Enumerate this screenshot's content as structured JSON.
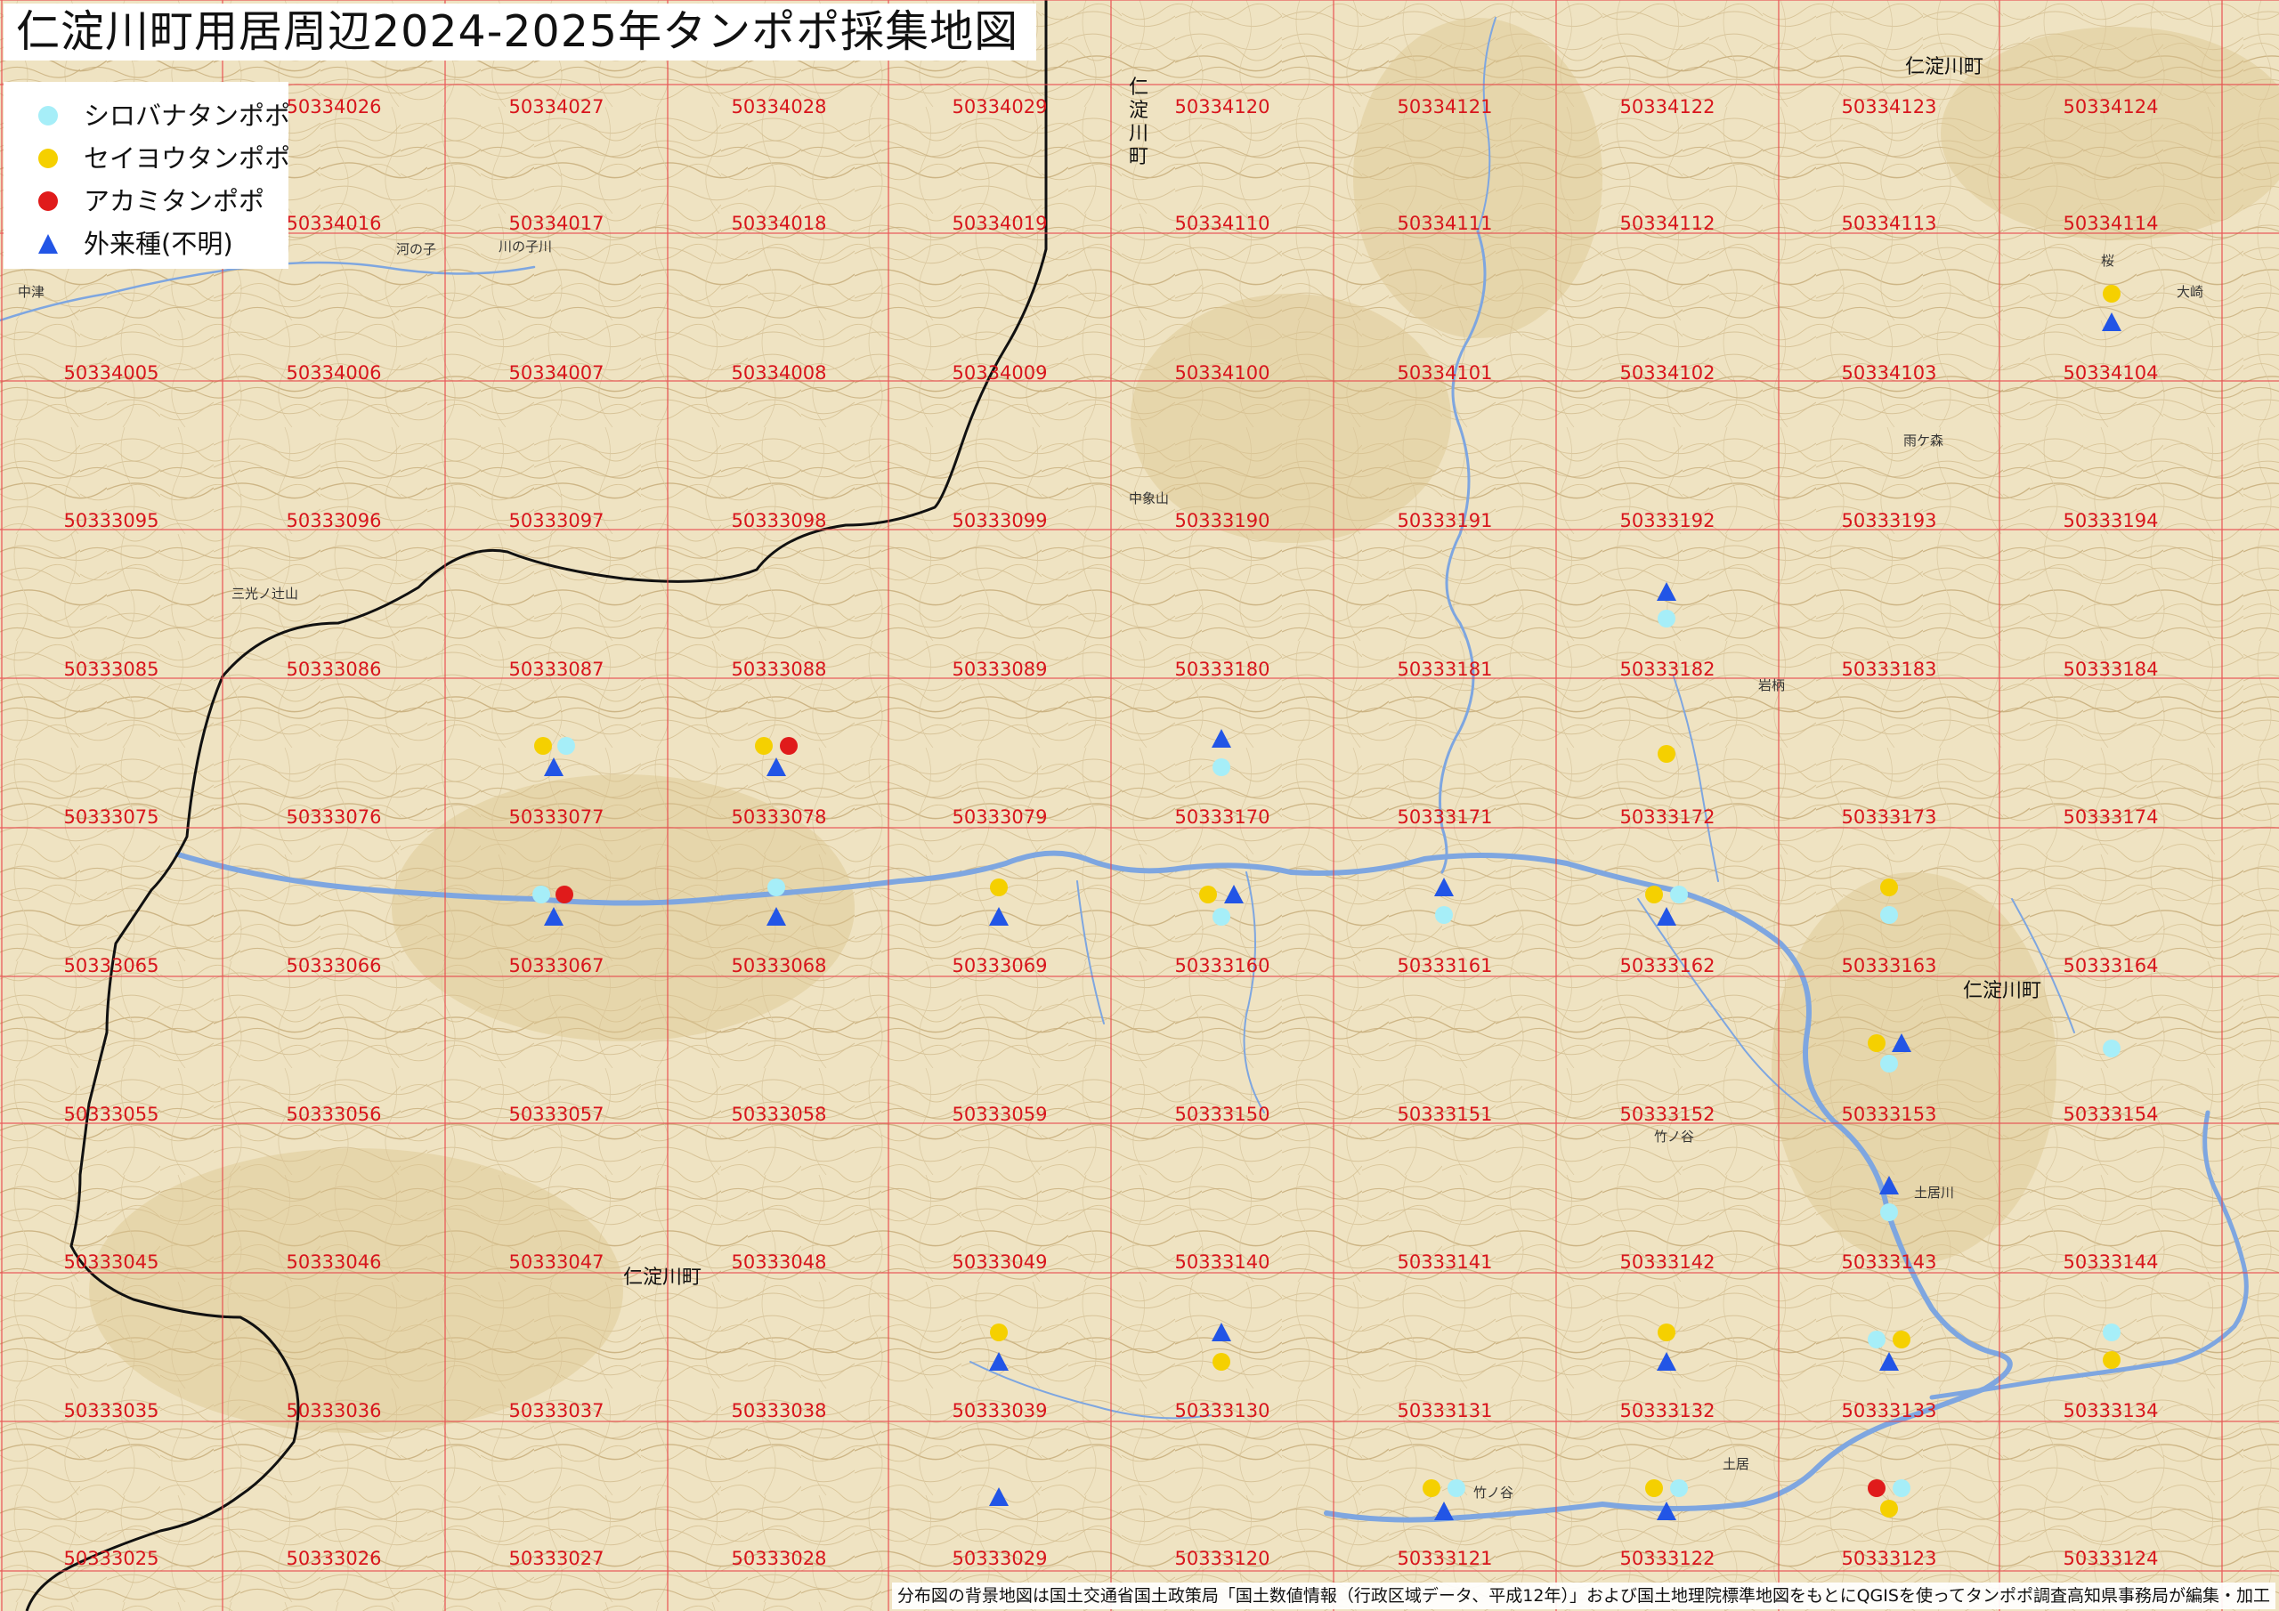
{
  "title": "仁淀川町用居周辺2024-2025年タンポポ採集地図",
  "legend": [
    {
      "key": "shirobana",
      "label": "シロバナタンポポ",
      "color": "#a6eef8",
      "shape": "circle"
    },
    {
      "key": "seiyou",
      "label": "セイヨウタンポポ",
      "color": "#f5d000",
      "shape": "circle"
    },
    {
      "key": "akami",
      "label": "アカミタンポポ",
      "color": "#e01b1b",
      "shape": "circle"
    },
    {
      "key": "gairai",
      "label": "外来種(不明)",
      "color": "#2255e6",
      "shape": "triangle"
    }
  ],
  "grid_rows": [
    [
      "50334026",
      "50334027",
      "50334028",
      "50334029",
      "50334120",
      "50334121",
      "50334122",
      "50334123",
      "50334124"
    ],
    [
      "50334016",
      "50334017",
      "50334018",
      "50334019",
      "50334110",
      "50334111",
      "50334112",
      "50334113",
      "50334114"
    ],
    [
      "50334005",
      "50334006",
      "50334007",
      "50334008",
      "50334009",
      "50334100",
      "50334101",
      "50334102",
      "50334103",
      "50334104"
    ],
    [
      "50333095",
      "50333096",
      "50333097",
      "50333098",
      "50333099",
      "50333190",
      "50333191",
      "50333192",
      "50333193",
      "50333194"
    ],
    [
      "50333085",
      "50333086",
      "50333087",
      "50333088",
      "50333089",
      "50333180",
      "50333181",
      "50333182",
      "50333183",
      "50333184"
    ],
    [
      "50333075",
      "50333076",
      "50333077",
      "50333078",
      "50333079",
      "50333170",
      "50333171",
      "50333172",
      "50333173",
      "50333174"
    ],
    [
      "50333065",
      "50333066",
      "50333067",
      "50333068",
      "50333069",
      "50333160",
      "50333161",
      "50333162",
      "50333163",
      "50333164"
    ],
    [
      "50333055",
      "50333056",
      "50333057",
      "50333058",
      "50333059",
      "50333150",
      "50333151",
      "50333152",
      "50333153",
      "50333154"
    ],
    [
      "50333045",
      "50333046",
      "50333047",
      "50333048",
      "50333049",
      "50333140",
      "50333141",
      "50333142",
      "50333143",
      "50333144"
    ],
    [
      "50333035",
      "50333036",
      "50333037",
      "50333038",
      "50333039",
      "50333130",
      "50333131",
      "50333132",
      "50333133",
      "50333134"
    ],
    [
      "50333025",
      "50333026",
      "50333027",
      "50333028",
      "50333029",
      "50333120",
      "50333121",
      "50333122",
      "50333123",
      "50333124"
    ]
  ],
  "town_labels": [
    "仁淀川町",
    "仁淀川町",
    "仁淀川町",
    "仁淀川町"
  ],
  "place_labels": [
    "中津",
    "河の子",
    "川の子川",
    "三光ノ辻山",
    "中象山",
    "雨ケ森",
    "竹ノ谷",
    "土居",
    "大崎",
    "岩柄",
    "土居川",
    "竹ノ谷",
    "桜"
  ],
  "survey_points": [
    {
      "species": "gairai",
      "cell": "50334114",
      "pos": "center"
    },
    {
      "species": "seiyou",
      "cell": "50334114",
      "pos": "upper"
    },
    {
      "species": "gairai",
      "cell": "50333192",
      "pos": "lower"
    },
    {
      "species": "shirobana",
      "cell": "50333192",
      "pos": "lower"
    }
  ],
  "footer": "分布図の背景地図は国土交通省国土政策局「国土数値情報（行政区域データ、平成12年）」および国土地理院標準地図をもとにQGISを使ってタンポポ調査高知県事務局が編集・加工"
}
